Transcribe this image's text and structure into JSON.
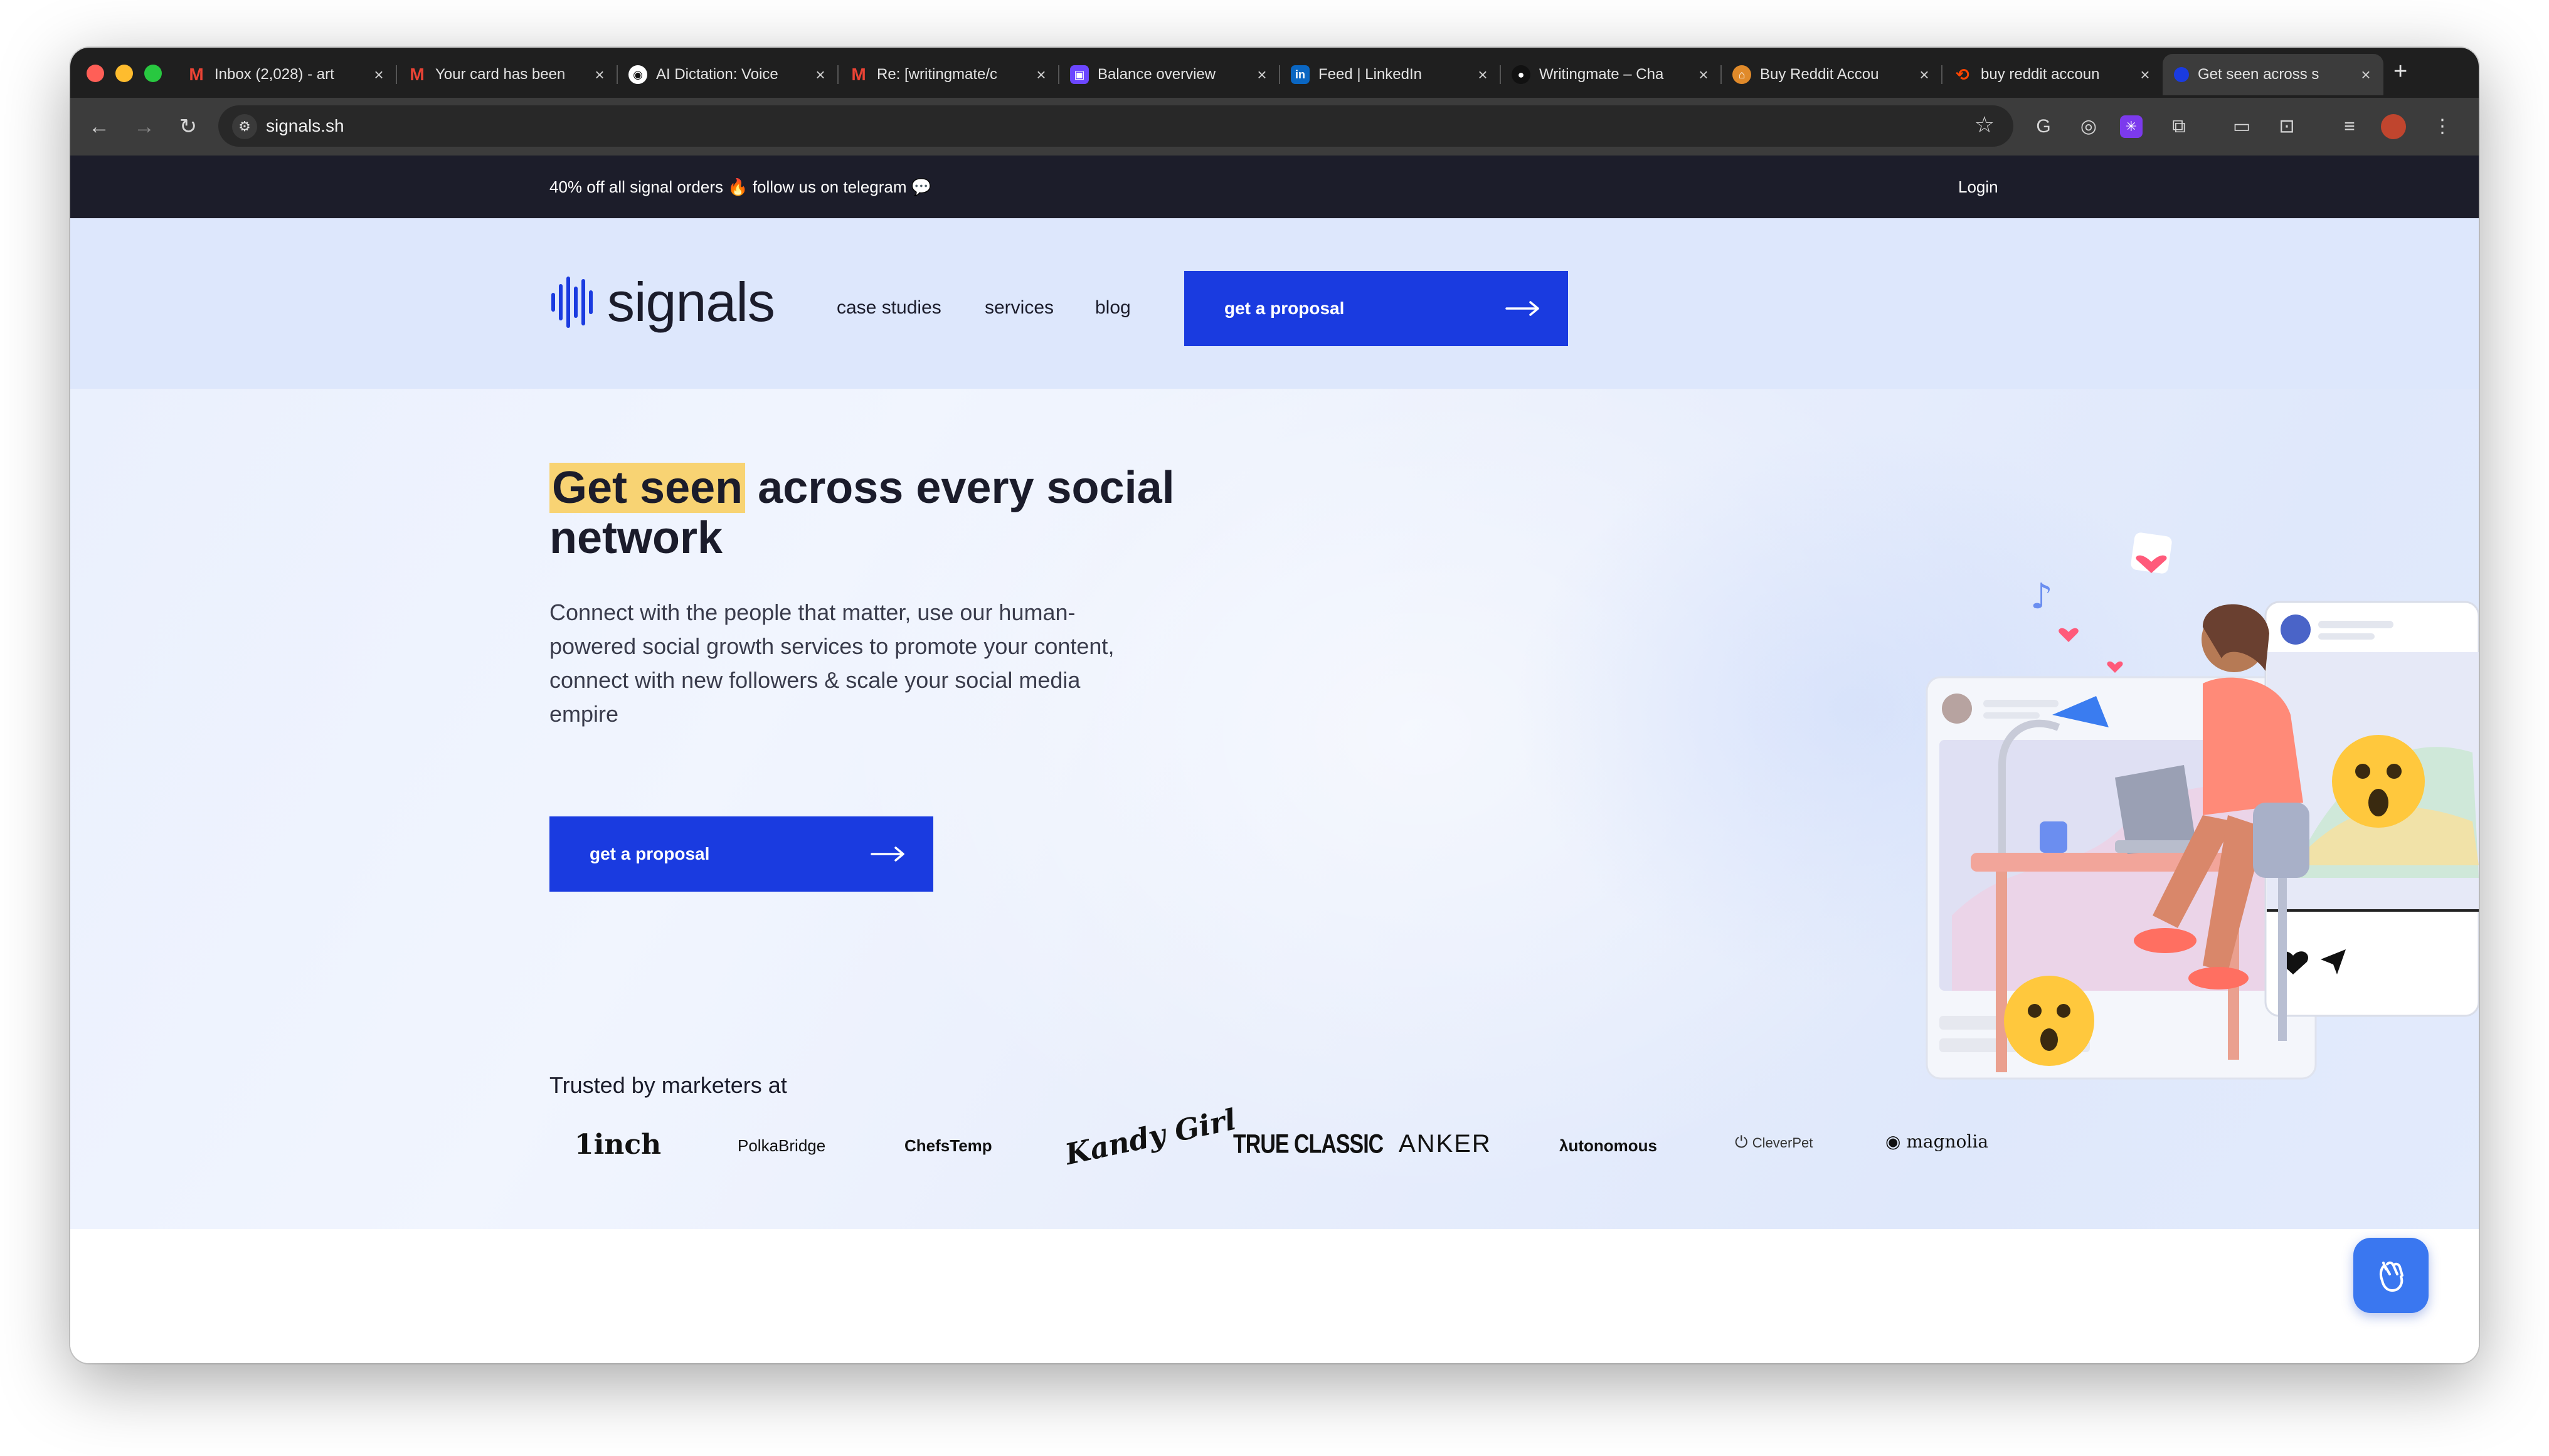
{
  "browser": {
    "tabs": [
      {
        "title": "Inbox (2,028) - art",
        "icon": "gmail-icon"
      },
      {
        "title": "Your card has been",
        "icon": "gmail-icon"
      },
      {
        "title": "AI Dictation: Voice",
        "icon": "dictation-icon"
      },
      {
        "title": "Re: [writingmate/c",
        "icon": "gmail-icon"
      },
      {
        "title": "Balance overview",
        "icon": "stripe-icon"
      },
      {
        "title": "Feed | LinkedIn",
        "icon": "linkedin-icon"
      },
      {
        "title": "Writingmate – Cha",
        "icon": "writingmate-icon"
      },
      {
        "title": "Buy Reddit Accou",
        "icon": "shop-icon"
      },
      {
        "title": "buy reddit accoun",
        "icon": "reddit-search-icon"
      },
      {
        "title": "Get seen across s",
        "icon": "signals-icon",
        "active": true
      }
    ],
    "new_tab": "+",
    "close": "×",
    "url": "signals.sh"
  },
  "announcement": {
    "message": "40% off all signal orders 🔥 follow us on telegram 💬",
    "login": "Login"
  },
  "nav": {
    "logo_text": "signals",
    "links": [
      "case studies",
      "services",
      "blog"
    ],
    "cta": "get a proposal"
  },
  "hero": {
    "headline_highlight": "Get seen",
    "headline_rest": " across every social network",
    "subtext": "Connect with the people that matter, use our human-powered social growth services to promote your content, connect with new followers & scale your social media empire",
    "cta": "get a proposal"
  },
  "trusted": {
    "label": "Trusted by marketers at",
    "brands": [
      "1inch",
      "PolkaBridge",
      "ChefsTemp",
      "Kandy Girl",
      "TRUE CLASSIC",
      "ANKER",
      "λutonomous",
      "CleverPet",
      "magnolia"
    ]
  },
  "colors": {
    "accent": "#1a3be0",
    "highlight": "#f8d373",
    "announce_bg": "#1c1d2a",
    "header_bg": "#dde7fc"
  }
}
